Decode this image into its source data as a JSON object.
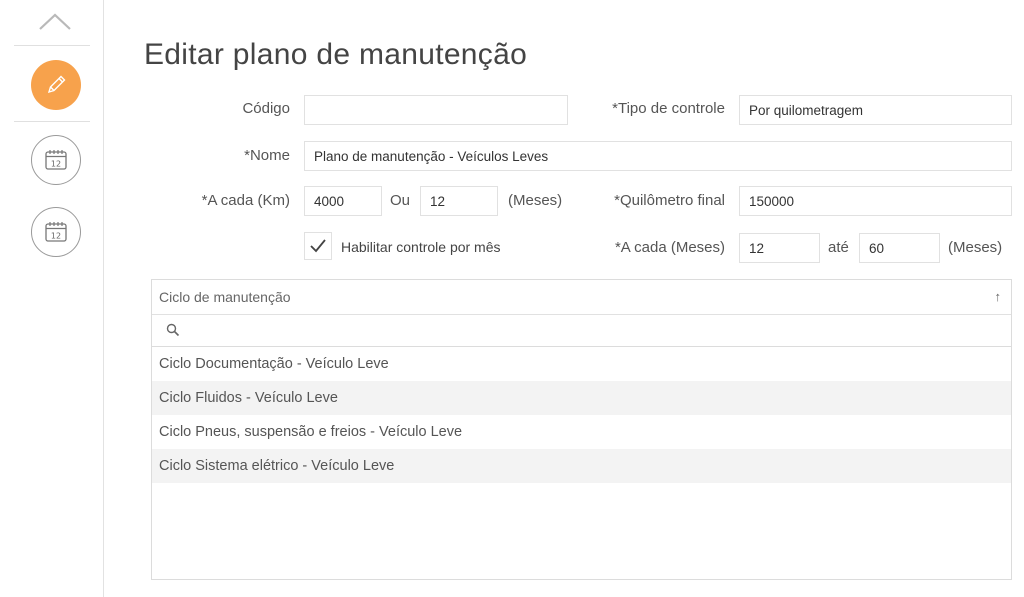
{
  "page": {
    "title": "Editar plano de manutenção"
  },
  "sidebar": {
    "items": [
      {
        "name": "edit",
        "icon": "pencil-icon",
        "active": true,
        "color": "#f7a24c"
      },
      {
        "name": "calendar-1",
        "icon": "calendar-icon",
        "day": "12"
      },
      {
        "name": "calendar-2",
        "icon": "calendar-icon",
        "day": "12"
      }
    ]
  },
  "form": {
    "codigo": {
      "label": "Código",
      "value": ""
    },
    "tipo_controle": {
      "label": "*Tipo de controle",
      "value": "Por quilometragem"
    },
    "nome": {
      "label": "*Nome",
      "value": "Plano de manutenção - Veículos Leves"
    },
    "a_cada_km": {
      "label": "*A cada (Km)",
      "value": "4000"
    },
    "ou": {
      "label": "Ou",
      "value": "12"
    },
    "meses_label": "(Meses)",
    "km_final": {
      "label": "*Quilômetro final",
      "value": "150000"
    },
    "habilitar": {
      "label": "Habilitar controle por mês",
      "checked": true
    },
    "a_cada_meses": {
      "label": "*A cada (Meses)",
      "value": "12"
    },
    "ate": {
      "label": "até",
      "value": "60"
    },
    "meses_label_2": "(Meses)"
  },
  "grid": {
    "header": "Ciclo de manutenção",
    "sort_icon": "↑",
    "search_placeholder": "",
    "rows": [
      "Ciclo Documentação - Veículo Leve",
      "Ciclo Fluidos - Veículo Leve",
      "Ciclo Pneus, suspensão e freios - Veículo Leve",
      "Ciclo Sistema elétrico - Veículo Leve"
    ]
  }
}
